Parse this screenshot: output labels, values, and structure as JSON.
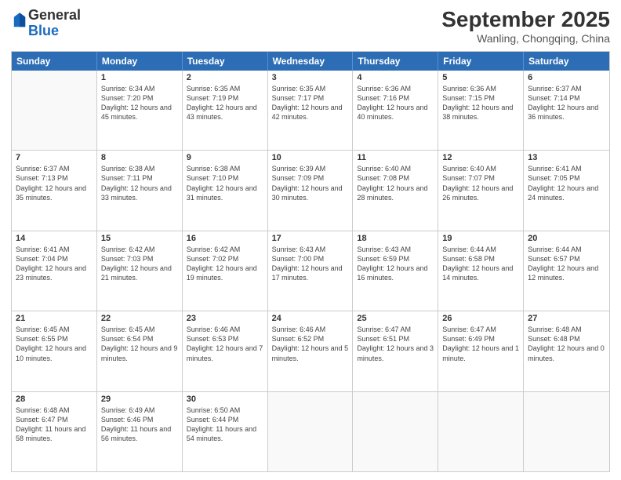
{
  "logo": {
    "general": "General",
    "blue": "Blue"
  },
  "header": {
    "month": "September 2025",
    "location": "Wanling, Chongqing, China"
  },
  "days": [
    "Sunday",
    "Monday",
    "Tuesday",
    "Wednesday",
    "Thursday",
    "Friday",
    "Saturday"
  ],
  "weeks": [
    [
      {
        "day": "",
        "sunrise": "",
        "sunset": "",
        "daylight": ""
      },
      {
        "day": "1",
        "sunrise": "Sunrise: 6:34 AM",
        "sunset": "Sunset: 7:20 PM",
        "daylight": "Daylight: 12 hours and 45 minutes."
      },
      {
        "day": "2",
        "sunrise": "Sunrise: 6:35 AM",
        "sunset": "Sunset: 7:19 PM",
        "daylight": "Daylight: 12 hours and 43 minutes."
      },
      {
        "day": "3",
        "sunrise": "Sunrise: 6:35 AM",
        "sunset": "Sunset: 7:17 PM",
        "daylight": "Daylight: 12 hours and 42 minutes."
      },
      {
        "day": "4",
        "sunrise": "Sunrise: 6:36 AM",
        "sunset": "Sunset: 7:16 PM",
        "daylight": "Daylight: 12 hours and 40 minutes."
      },
      {
        "day": "5",
        "sunrise": "Sunrise: 6:36 AM",
        "sunset": "Sunset: 7:15 PM",
        "daylight": "Daylight: 12 hours and 38 minutes."
      },
      {
        "day": "6",
        "sunrise": "Sunrise: 6:37 AM",
        "sunset": "Sunset: 7:14 PM",
        "daylight": "Daylight: 12 hours and 36 minutes."
      }
    ],
    [
      {
        "day": "7",
        "sunrise": "Sunrise: 6:37 AM",
        "sunset": "Sunset: 7:13 PM",
        "daylight": "Daylight: 12 hours and 35 minutes."
      },
      {
        "day": "8",
        "sunrise": "Sunrise: 6:38 AM",
        "sunset": "Sunset: 7:11 PM",
        "daylight": "Daylight: 12 hours and 33 minutes."
      },
      {
        "day": "9",
        "sunrise": "Sunrise: 6:38 AM",
        "sunset": "Sunset: 7:10 PM",
        "daylight": "Daylight: 12 hours and 31 minutes."
      },
      {
        "day": "10",
        "sunrise": "Sunrise: 6:39 AM",
        "sunset": "Sunset: 7:09 PM",
        "daylight": "Daylight: 12 hours and 30 minutes."
      },
      {
        "day": "11",
        "sunrise": "Sunrise: 6:40 AM",
        "sunset": "Sunset: 7:08 PM",
        "daylight": "Daylight: 12 hours and 28 minutes."
      },
      {
        "day": "12",
        "sunrise": "Sunrise: 6:40 AM",
        "sunset": "Sunset: 7:07 PM",
        "daylight": "Daylight: 12 hours and 26 minutes."
      },
      {
        "day": "13",
        "sunrise": "Sunrise: 6:41 AM",
        "sunset": "Sunset: 7:05 PM",
        "daylight": "Daylight: 12 hours and 24 minutes."
      }
    ],
    [
      {
        "day": "14",
        "sunrise": "Sunrise: 6:41 AM",
        "sunset": "Sunset: 7:04 PM",
        "daylight": "Daylight: 12 hours and 23 minutes."
      },
      {
        "day": "15",
        "sunrise": "Sunrise: 6:42 AM",
        "sunset": "Sunset: 7:03 PM",
        "daylight": "Daylight: 12 hours and 21 minutes."
      },
      {
        "day": "16",
        "sunrise": "Sunrise: 6:42 AM",
        "sunset": "Sunset: 7:02 PM",
        "daylight": "Daylight: 12 hours and 19 minutes."
      },
      {
        "day": "17",
        "sunrise": "Sunrise: 6:43 AM",
        "sunset": "Sunset: 7:00 PM",
        "daylight": "Daylight: 12 hours and 17 minutes."
      },
      {
        "day": "18",
        "sunrise": "Sunrise: 6:43 AM",
        "sunset": "Sunset: 6:59 PM",
        "daylight": "Daylight: 12 hours and 16 minutes."
      },
      {
        "day": "19",
        "sunrise": "Sunrise: 6:44 AM",
        "sunset": "Sunset: 6:58 PM",
        "daylight": "Daylight: 12 hours and 14 minutes."
      },
      {
        "day": "20",
        "sunrise": "Sunrise: 6:44 AM",
        "sunset": "Sunset: 6:57 PM",
        "daylight": "Daylight: 12 hours and 12 minutes."
      }
    ],
    [
      {
        "day": "21",
        "sunrise": "Sunrise: 6:45 AM",
        "sunset": "Sunset: 6:55 PM",
        "daylight": "Daylight: 12 hours and 10 minutes."
      },
      {
        "day": "22",
        "sunrise": "Sunrise: 6:45 AM",
        "sunset": "Sunset: 6:54 PM",
        "daylight": "Daylight: 12 hours and 9 minutes."
      },
      {
        "day": "23",
        "sunrise": "Sunrise: 6:46 AM",
        "sunset": "Sunset: 6:53 PM",
        "daylight": "Daylight: 12 hours and 7 minutes."
      },
      {
        "day": "24",
        "sunrise": "Sunrise: 6:46 AM",
        "sunset": "Sunset: 6:52 PM",
        "daylight": "Daylight: 12 hours and 5 minutes."
      },
      {
        "day": "25",
        "sunrise": "Sunrise: 6:47 AM",
        "sunset": "Sunset: 6:51 PM",
        "daylight": "Daylight: 12 hours and 3 minutes."
      },
      {
        "day": "26",
        "sunrise": "Sunrise: 6:47 AM",
        "sunset": "Sunset: 6:49 PM",
        "daylight": "Daylight: 12 hours and 1 minute."
      },
      {
        "day": "27",
        "sunrise": "Sunrise: 6:48 AM",
        "sunset": "Sunset: 6:48 PM",
        "daylight": "Daylight: 12 hours and 0 minutes."
      }
    ],
    [
      {
        "day": "28",
        "sunrise": "Sunrise: 6:48 AM",
        "sunset": "Sunset: 6:47 PM",
        "daylight": "Daylight: 11 hours and 58 minutes."
      },
      {
        "day": "29",
        "sunrise": "Sunrise: 6:49 AM",
        "sunset": "Sunset: 6:46 PM",
        "daylight": "Daylight: 11 hours and 56 minutes."
      },
      {
        "day": "30",
        "sunrise": "Sunrise: 6:50 AM",
        "sunset": "Sunset: 6:44 PM",
        "daylight": "Daylight: 11 hours and 54 minutes."
      },
      {
        "day": "",
        "sunrise": "",
        "sunset": "",
        "daylight": ""
      },
      {
        "day": "",
        "sunrise": "",
        "sunset": "",
        "daylight": ""
      },
      {
        "day": "",
        "sunrise": "",
        "sunset": "",
        "daylight": ""
      },
      {
        "day": "",
        "sunrise": "",
        "sunset": "",
        "daylight": ""
      }
    ]
  ]
}
